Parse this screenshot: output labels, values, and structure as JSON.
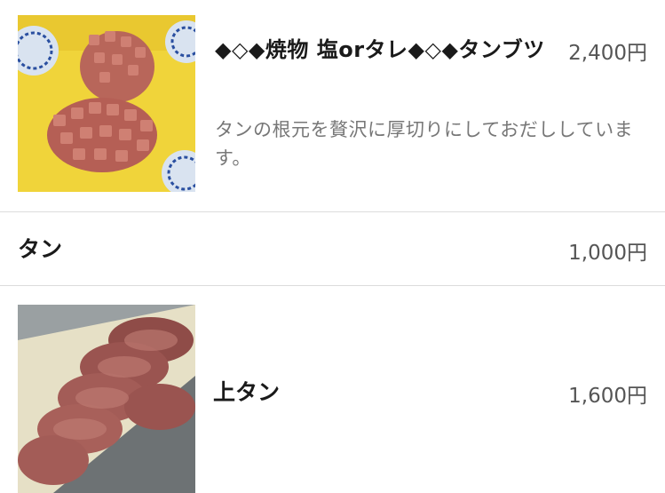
{
  "menu": {
    "items": [
      {
        "name": "◆◇◆焼物 塩orタレ◆◇◆タンブツ",
        "price": "2,400円",
        "description": "タンの根元を贅沢に厚切りにしておだししています。",
        "has_image": true
      },
      {
        "name": "タン",
        "price": "1,000円",
        "has_image": false
      },
      {
        "name": "上タン",
        "price": "1,600円",
        "has_image": true
      }
    ]
  }
}
